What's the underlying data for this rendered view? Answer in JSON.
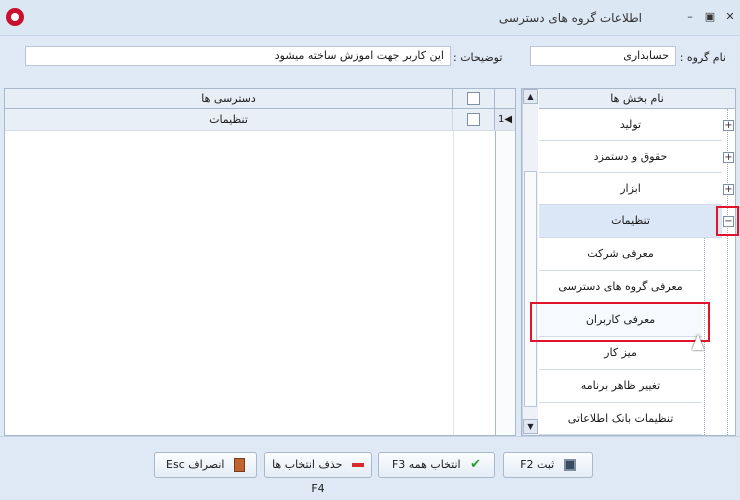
{
  "window": {
    "title": "اطلاعات گروه های دسترسی",
    "minimize_glyph": "–",
    "maximize_glyph": "▣",
    "close_glyph": "✕"
  },
  "form": {
    "group_name_label": "نام گروه :",
    "group_name_value": "حسابداری",
    "description_label": "توضیحات :",
    "description_value": "این کاربر جهت اموزش ساخته میشود"
  },
  "left_grid": {
    "header": "دسترسی ها",
    "row_indicator": "1",
    "rows": [
      {
        "label": "تنظیمات",
        "checked": false
      }
    ]
  },
  "right_grid": {
    "header": "نام بخش ها",
    "sections": [
      {
        "label": "تولید",
        "expander": "+"
      },
      {
        "label": "حقوق و دستمزد",
        "expander": "+"
      },
      {
        "label": "ابزار",
        "expander": "+"
      },
      {
        "label": "تنظیمات",
        "expander": "−"
      }
    ],
    "subitems": [
      {
        "label": "معرفی شرکت"
      },
      {
        "label": "معرفی گروه های دسترسی"
      },
      {
        "label": "معرفی کاربران"
      },
      {
        "label": "میز کار"
      },
      {
        "label": "تغییر ظاهر برنامه"
      },
      {
        "label": "تنظیمات بانک اطلاعاتی"
      }
    ]
  },
  "buttons": {
    "cancel": "انصراف Esc",
    "deselect_all": "حذف انتخاب ها F4",
    "select_all": "انتخاب همه F3",
    "save": "ثبت F2"
  },
  "icons": {
    "app": "app-logo-icon",
    "cancel": "exit-door-icon",
    "deselect": "minus-icon",
    "select_all": "check-icon",
    "save": "floppy-disk-icon"
  },
  "colors": {
    "highlight": "#e0142a",
    "selected_row": "#dbe7f6",
    "background": "#dfe9f5"
  }
}
